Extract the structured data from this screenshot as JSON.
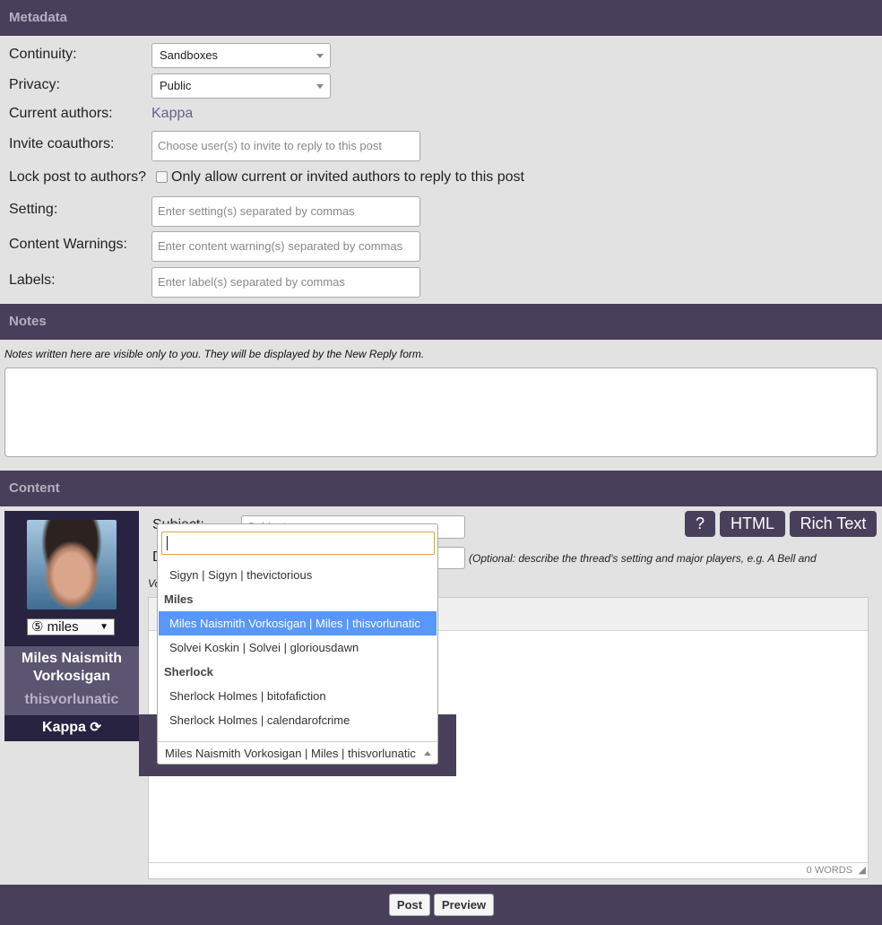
{
  "metadata": {
    "header": "Metadata",
    "continuity_label": "Continuity:",
    "continuity_value": "Sandboxes",
    "privacy_label": "Privacy:",
    "privacy_value": "Public",
    "authors_label": "Current authors:",
    "authors_value": "Kappa",
    "coauthors_label": "Invite coauthors:",
    "coauthors_placeholder": "Choose user(s) to invite to reply to this post",
    "lock_label": "Lock post to authors?",
    "lock_text": "Only allow current or invited authors to reply to this post",
    "setting_label": "Setting:",
    "setting_placeholder": "Enter setting(s) separated by commas",
    "warnings_label": "Content Warnings:",
    "warnings_placeholder": "Enter content warning(s) separated by commas",
    "labels_label": "Labels:",
    "labels_placeholder": "Enter label(s) separated by commas"
  },
  "notes": {
    "header": "Notes",
    "description": "Notes written here are visible only to you. They will be displayed by the New Reply form."
  },
  "content": {
    "header": "Content",
    "subject_label": "Subject:",
    "subject_placeholder": "Subject",
    "description_label": "D",
    "description_hint": "(Optional: describe the thread's setting and major players, e.g. A Bell and",
    "description_hint_wrap": "Vo",
    "help_button": "?",
    "html_button": "HTML",
    "rich_text_button": "Rich Text",
    "word_count": "0 WORDS",
    "colors": {
      "accent": "#48405b",
      "selected": "#5897fb"
    }
  },
  "character": {
    "icon_name": "⑤ miles",
    "name": "Miles Naismith Vorkosigan",
    "screenname": "thisvorlunatic",
    "user": "Kappa",
    "swap_icon": "refresh-icon"
  },
  "dropdown": {
    "search_value": "",
    "items": [
      {
        "kind": "option",
        "text": "Sigyn | Sigyn | thevictorious"
      },
      {
        "kind": "group",
        "text": "Miles"
      },
      {
        "kind": "option",
        "text": "Miles Naismith Vorkosigan | Miles | thisvorlunatic",
        "selected": true
      },
      {
        "kind": "option",
        "text": "Solvei Koskin | Solvei | gloriousdawn"
      },
      {
        "kind": "group",
        "text": "Sherlock"
      },
      {
        "kind": "option",
        "text": "Sherlock Holmes | bitofafiction"
      },
      {
        "kind": "option",
        "text": "Sherlock Holmes | calendarofcrime"
      }
    ],
    "selected_value": "Miles Naismith Vorkosigan | Miles | thisvorlunatic"
  },
  "footer": {
    "post_button": "Post",
    "preview_button": "Preview"
  }
}
